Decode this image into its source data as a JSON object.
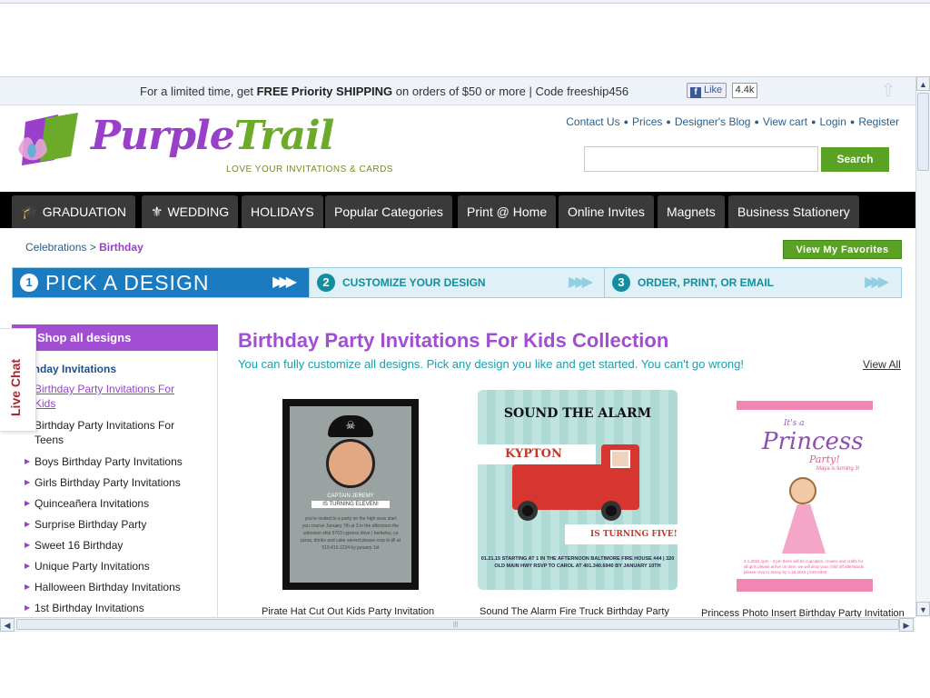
{
  "promo": {
    "prefix": "For a limited time, get ",
    "bold": "FREE Priority SHIPPING",
    "suffix": " on orders of $50 or more | Code freeship456",
    "fb_like": "Like",
    "fb_count": "4.4k"
  },
  "header": {
    "logo_part1": "Purple",
    "logo_part2": "Trail",
    "tagline": "LOVE YOUR INVITATIONS & CARDS",
    "links": [
      "Contact Us",
      "Prices",
      "Designer's Blog",
      "View cart",
      "Login",
      "Register"
    ],
    "search_button": "Search",
    "search_placeholder": ""
  },
  "nav": {
    "tabs": [
      {
        "label": "GRADUATION",
        "icon": "graduation-cap-icon"
      },
      {
        "label": "WEDDING",
        "icon": "fleur-de-lis-icon"
      },
      {
        "label": "HOLIDAYS"
      },
      {
        "label": "Popular Categories"
      },
      {
        "label": "Print @ Home"
      },
      {
        "label": "Online Invites"
      },
      {
        "label": "Magnets"
      },
      {
        "label": "Business Stationery"
      }
    ]
  },
  "breadcrumb": {
    "parent": "Celebrations",
    "separator": " > ",
    "current": "Birthday"
  },
  "favorites_button": "View My Favorites",
  "steps": [
    {
      "num": "1",
      "label": "PICK A DESIGN"
    },
    {
      "num": "2",
      "label": "CUSTOMIZE YOUR DESIGN"
    },
    {
      "num": "3",
      "label": "ORDER, PRINT, OR EMAIL"
    }
  ],
  "sidebar": {
    "header": "Shop all designs",
    "category": "rthday Invitations",
    "items": [
      "Birthday Party Invitations For Kids",
      "Birthday Party Invitations For Teens",
      "Boys Birthday Party Invitations",
      "Girls Birthday Party Invitations",
      "Quinceañera Invitations",
      "Surprise Birthday Party",
      "Sweet 16 Birthday",
      "Unique Party Invitations",
      "Halloween Birthday Invitations",
      "1st Birthday Invitations"
    ],
    "live_chat": "Live Chat"
  },
  "main": {
    "title": "Birthday Party Invitations For Kids Collection",
    "subtitle": "You can fully customize all designs. Pick any design you like and get started. You can't go wrong!",
    "view_all": "View All"
  },
  "cards": [
    {
      "label": "Pirate Hat Cut Out Kids Party Invitation",
      "art": {
        "captain": "CAPTAIN JEREMY",
        "turning": "IS TURNING ELEVEN!",
        "details": "you're invited to a party on the high seas start you course January 7th at 3 in the afternoon the unknown ship 5763 cypress drive | berkeley, ca pizza, drinks and cake served please rsvp to jill at 510.410.1234 by january 1st"
      }
    },
    {
      "label": "Sound The Alarm Fire Truck Birthday Party",
      "art": {
        "title": "SOUND THE ALARM",
        "name": "KYPTON",
        "turning": "IS TURNING FIVE!",
        "details": "01.21.15 STARTING AT 1 IN THE AFTERNOON BALTIMORE FIRE HOUSE #44 | 320 OLD MAIN HWY RSVP TO CAROL AT 401.340.6940 BY JANUARY 10TH"
      }
    },
    {
      "label": "Princess Photo Insert Birthday Party Invitation",
      "art": {
        "its": "It's a",
        "title": "Princess",
        "party": "Party!",
        "sub": "Maya is turning 3!",
        "details": "2.1.2015 1pm - 3 pm there will be cupcakes, crowns and crafts for all girls please arrive on time, we will drop your child off afterwards please rsvp to Jenny by 1.15.2015 | 548-9302"
      }
    }
  ],
  "colors": {
    "brand_purple": "#a24ed3",
    "brand_green": "#5aa224",
    "teal": "#16a0b0",
    "nav_bg": "#000000"
  }
}
